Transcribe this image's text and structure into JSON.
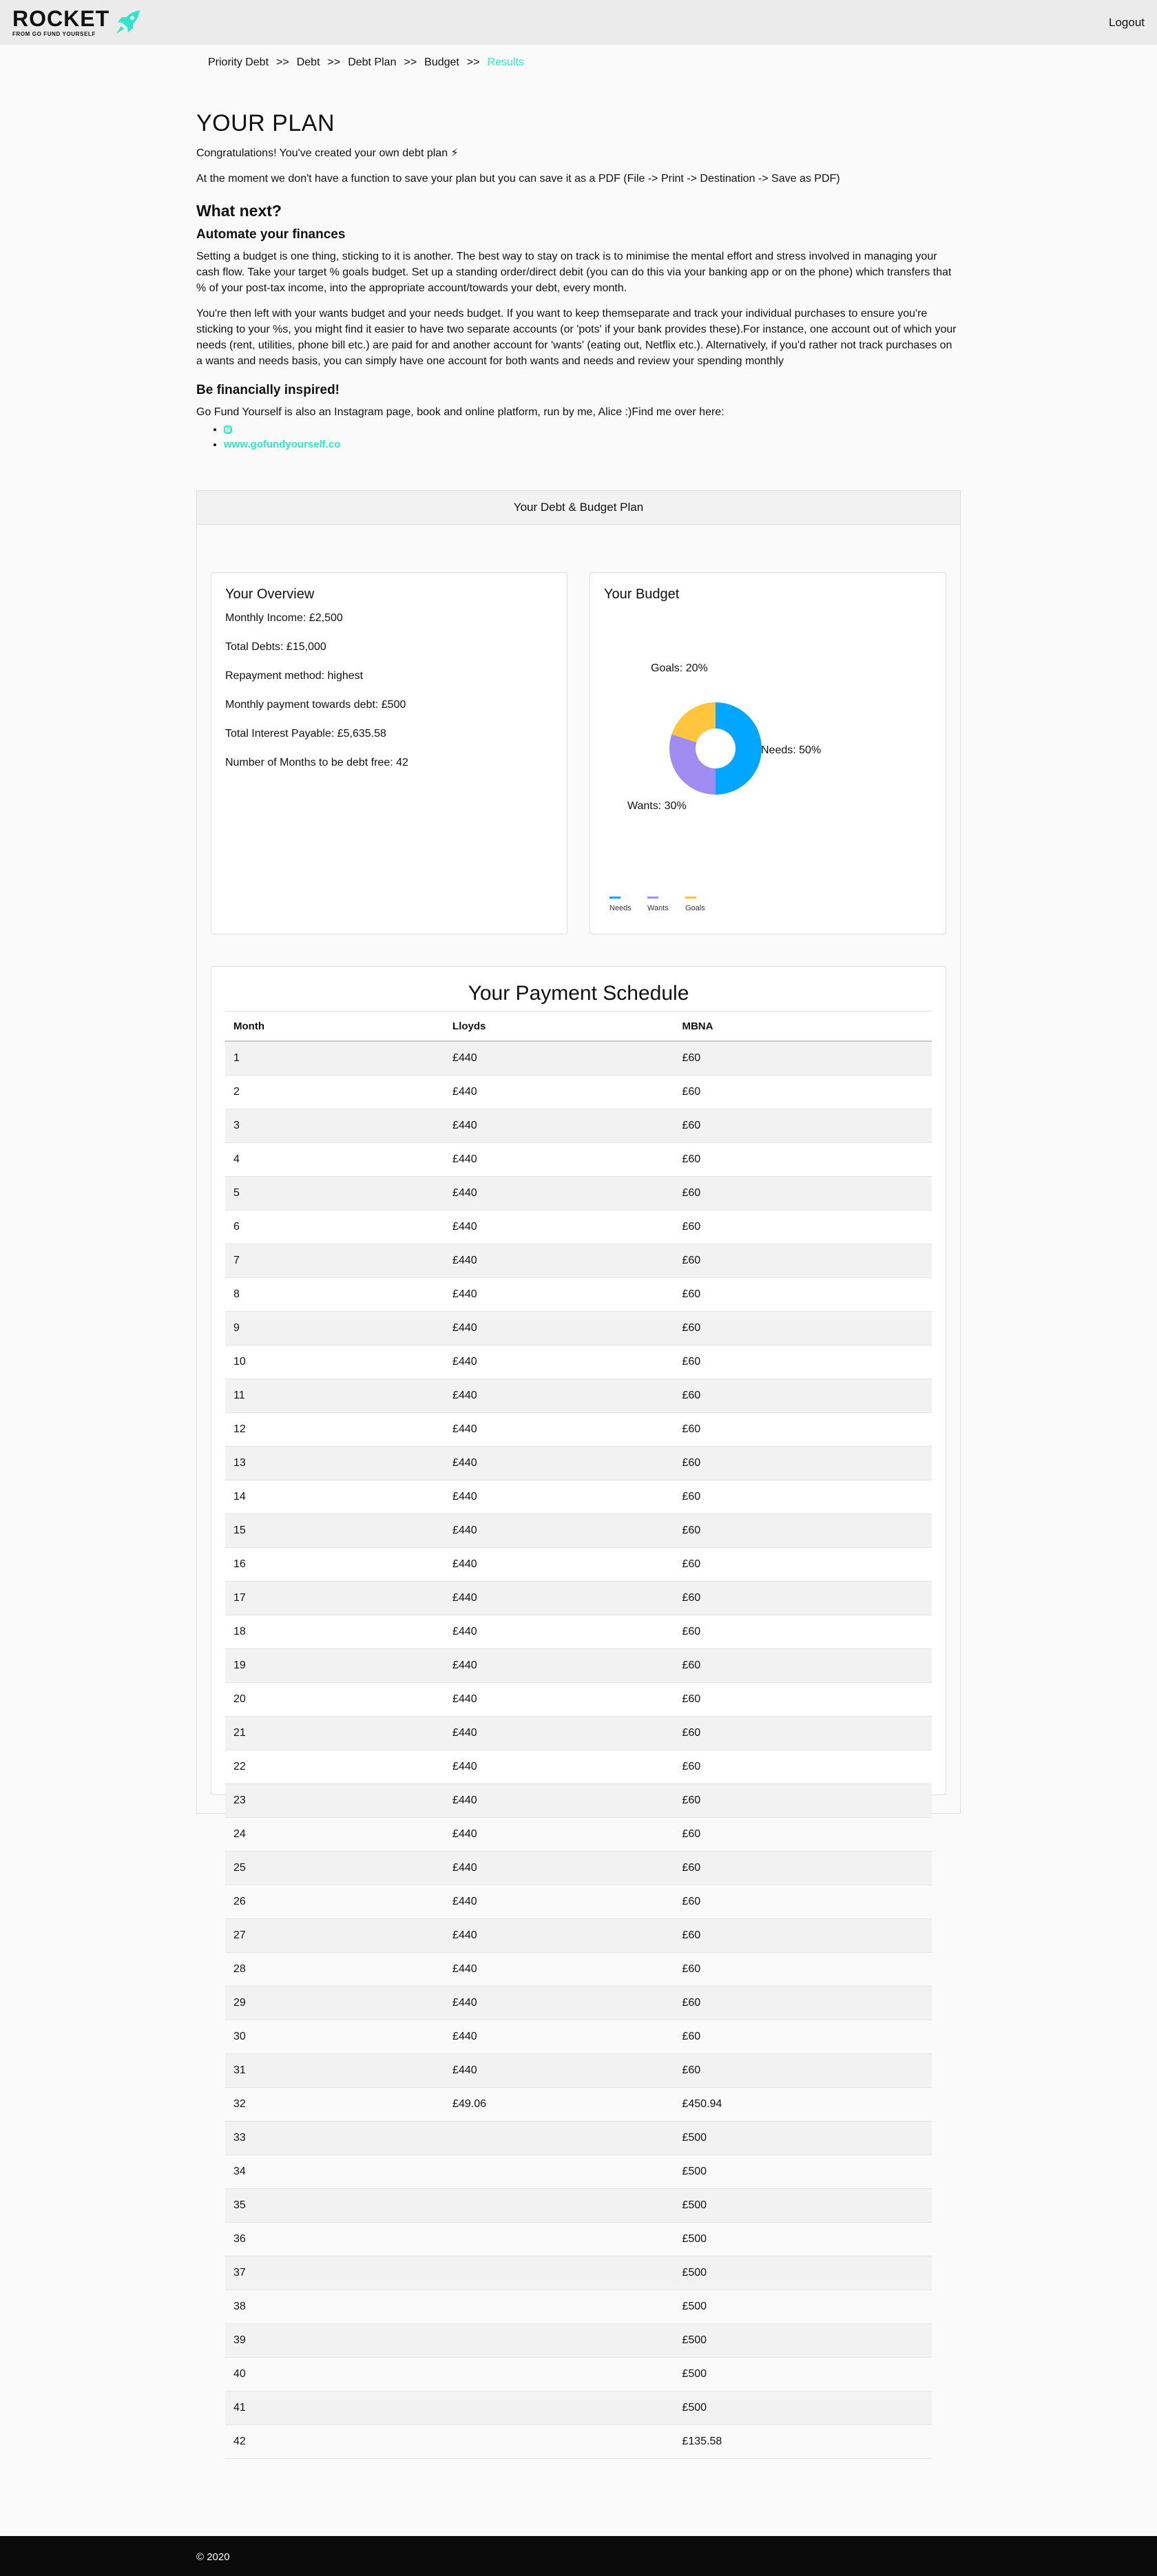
{
  "header": {
    "logo_word": "ROCKET",
    "logo_sub": "FROM GO FUND YOURSELF",
    "logout_label": "Logout"
  },
  "breadcrumb": {
    "items": [
      "Priority Debt",
      "Debt",
      "Debt Plan",
      "Budget",
      "Results"
    ],
    "separator": ">>",
    "active_color": "#2ee6c9"
  },
  "intro": {
    "title": "YOUR PLAN",
    "congrats": "Congratulations! You've created your own debt plan ⚡",
    "save_note": "At the moment we don't have a function to save your plan but you can save it as a PDF (File -> Print -> Destination -> Save as PDF)",
    "what_next": "What next?",
    "automate_heading": "Automate your finances",
    "automate_p1": "Setting a budget is one thing, sticking to it is another. The best way to stay on track is to minimise the mental effort and stress involved in managing your cash flow. Take your target % goals budget. Set up a standing order/direct debit (you can do this via your banking app or on the phone) which transfers that % of your post-tax income, into the appropriate account/towards your debt, every month.",
    "automate_p2": "You're then left with your wants budget and your needs budget. If you want to keep themseparate and track your individual purchases to ensure you're sticking to your %s, you might find it easier to have two separate accounts (or 'pots' if your bank provides these).For instance, one account out of which your needs (rent, utilities, phone bill etc.) are paid for and another account for 'wants' (eating out, Netflix etc.). Alternatively, if you'd rather not track purchases on a wants and needs basis, you can simply have one account for both wants and needs and review your spending monthly",
    "inspired_heading": "Be financially inspired!",
    "inspired_p": "Go Fund Yourself is also an Instagram page, book and online platform, run by me, Alice :)Find me over here:",
    "links": [
      "www.gofundyourself.co"
    ],
    "instagram_icon": "instagram-icon"
  },
  "plan": {
    "header": "Your Debt & Budget Plan",
    "overview": {
      "title": "Your Overview",
      "lines": [
        "Monthly Income: £2,500",
        "Total Debts: £15,000",
        "Repayment method: highest",
        "Monthly payment towards debt: £500",
        "Total Interest Payable: £5,635.58",
        "Number of Months to be debt free: 42"
      ]
    },
    "budget": {
      "title": "Your Budget"
    },
    "schedule": {
      "title": "Your Payment Schedule",
      "columns": [
        "Month",
        "Lloyds",
        "MBNA"
      ],
      "rows": [
        [
          "1",
          "£440",
          "£60"
        ],
        [
          "2",
          "£440",
          "£60"
        ],
        [
          "3",
          "£440",
          "£60"
        ],
        [
          "4",
          "£440",
          "£60"
        ],
        [
          "5",
          "£440",
          "£60"
        ],
        [
          "6",
          "£440",
          "£60"
        ],
        [
          "7",
          "£440",
          "£60"
        ],
        [
          "8",
          "£440",
          "£60"
        ],
        [
          "9",
          "£440",
          "£60"
        ],
        [
          "10",
          "£440",
          "£60"
        ],
        [
          "11",
          "£440",
          "£60"
        ],
        [
          "12",
          "£440",
          "£60"
        ],
        [
          "13",
          "£440",
          "£60"
        ],
        [
          "14",
          "£440",
          "£60"
        ],
        [
          "15",
          "£440",
          "£60"
        ],
        [
          "16",
          "£440",
          "£60"
        ],
        [
          "17",
          "£440",
          "£60"
        ],
        [
          "18",
          "£440",
          "£60"
        ],
        [
          "19",
          "£440",
          "£60"
        ],
        [
          "20",
          "£440",
          "£60"
        ],
        [
          "21",
          "£440",
          "£60"
        ],
        [
          "22",
          "£440",
          "£60"
        ],
        [
          "23",
          "£440",
          "£60"
        ],
        [
          "24",
          "£440",
          "£60"
        ],
        [
          "25",
          "£440",
          "£60"
        ],
        [
          "26",
          "£440",
          "£60"
        ],
        [
          "27",
          "£440",
          "£60"
        ],
        [
          "28",
          "£440",
          "£60"
        ],
        [
          "29",
          "£440",
          "£60"
        ],
        [
          "30",
          "£440",
          "£60"
        ],
        [
          "31",
          "£440",
          "£60"
        ],
        [
          "32",
          "£49.06",
          "£450.94"
        ],
        [
          "33",
          "",
          "£500"
        ],
        [
          "34",
          "",
          "£500"
        ],
        [
          "35",
          "",
          "£500"
        ],
        [
          "36",
          "",
          "£500"
        ],
        [
          "37",
          "",
          "£500"
        ],
        [
          "38",
          "",
          "£500"
        ],
        [
          "39",
          "",
          "£500"
        ],
        [
          "40",
          "",
          "£500"
        ],
        [
          "41",
          "",
          "£500"
        ],
        [
          "42",
          "",
          "£135.58"
        ]
      ]
    }
  },
  "chart_data": {
    "type": "pie",
    "donut": true,
    "categories": [
      "Needs",
      "Wants",
      "Goals"
    ],
    "values": [
      50,
      30,
      20
    ],
    "slice_labels": [
      "Needs: 50%",
      "Wants: 30%",
      "Goals: 20%"
    ],
    "colors": [
      "#00a6ff",
      "#a18cf2",
      "#ffc53d"
    ],
    "legend_position": "bottom-left"
  },
  "footer": {
    "copyright": "© 2020"
  }
}
